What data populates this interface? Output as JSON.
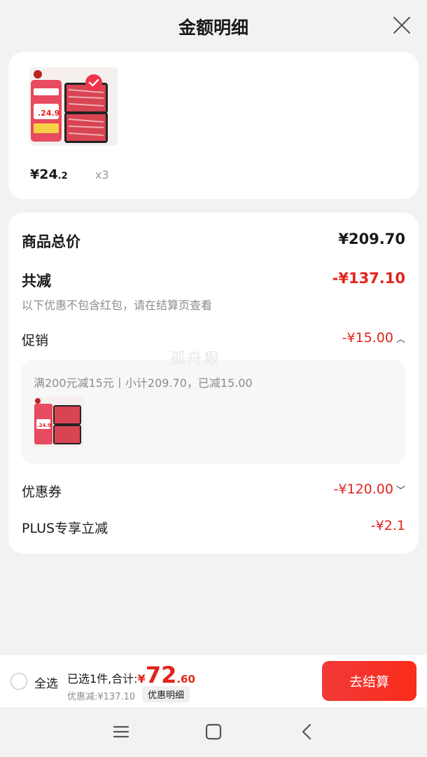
{
  "header": {
    "title": "金额明细",
    "close_icon": "close-icon"
  },
  "product": {
    "thumbnail_icon": "meat-tray-image",
    "selected_icon": "check-circle-icon",
    "price_main": "¥24",
    "price_decimal": ".2",
    "quantity": "x3"
  },
  "summary": {
    "total_price_label": "商品总价",
    "total_price_value": "¥209.70",
    "reduction_label": "共减",
    "reduction_value": "-¥137.10",
    "reduction_note": "以下优惠不包含红包，请在结算页查看",
    "promotion_label": "促销",
    "promotion_value": "-¥15.00",
    "promotion_detail": "满200元减15元丨小计209.70，已减15.00",
    "coupon_label": "优惠券",
    "coupon_value": "-¥120.00",
    "plus_label": "PLUS专享立减",
    "plus_value": "-¥2.1"
  },
  "watermark": "孤舟狠",
  "footer": {
    "select_all_label": "全选",
    "selected_text": "已选1件,合计:",
    "currency": "¥",
    "total_main": "72",
    "total_decimal": ".60",
    "discount_text": "优惠减:¥137.10",
    "detail_tag": "优惠明细",
    "checkout_label": "去结算"
  },
  "navbar": {
    "menu_icon": "menu-icon",
    "home_icon": "home-square-icon",
    "back_icon": "back-chevron-icon"
  },
  "colors": {
    "accent_red": "#e1251b",
    "checkout_gradient_start": "#f23a3a",
    "checkout_gradient_end": "#fa2c19",
    "page_bg": "#f2f2f2"
  }
}
